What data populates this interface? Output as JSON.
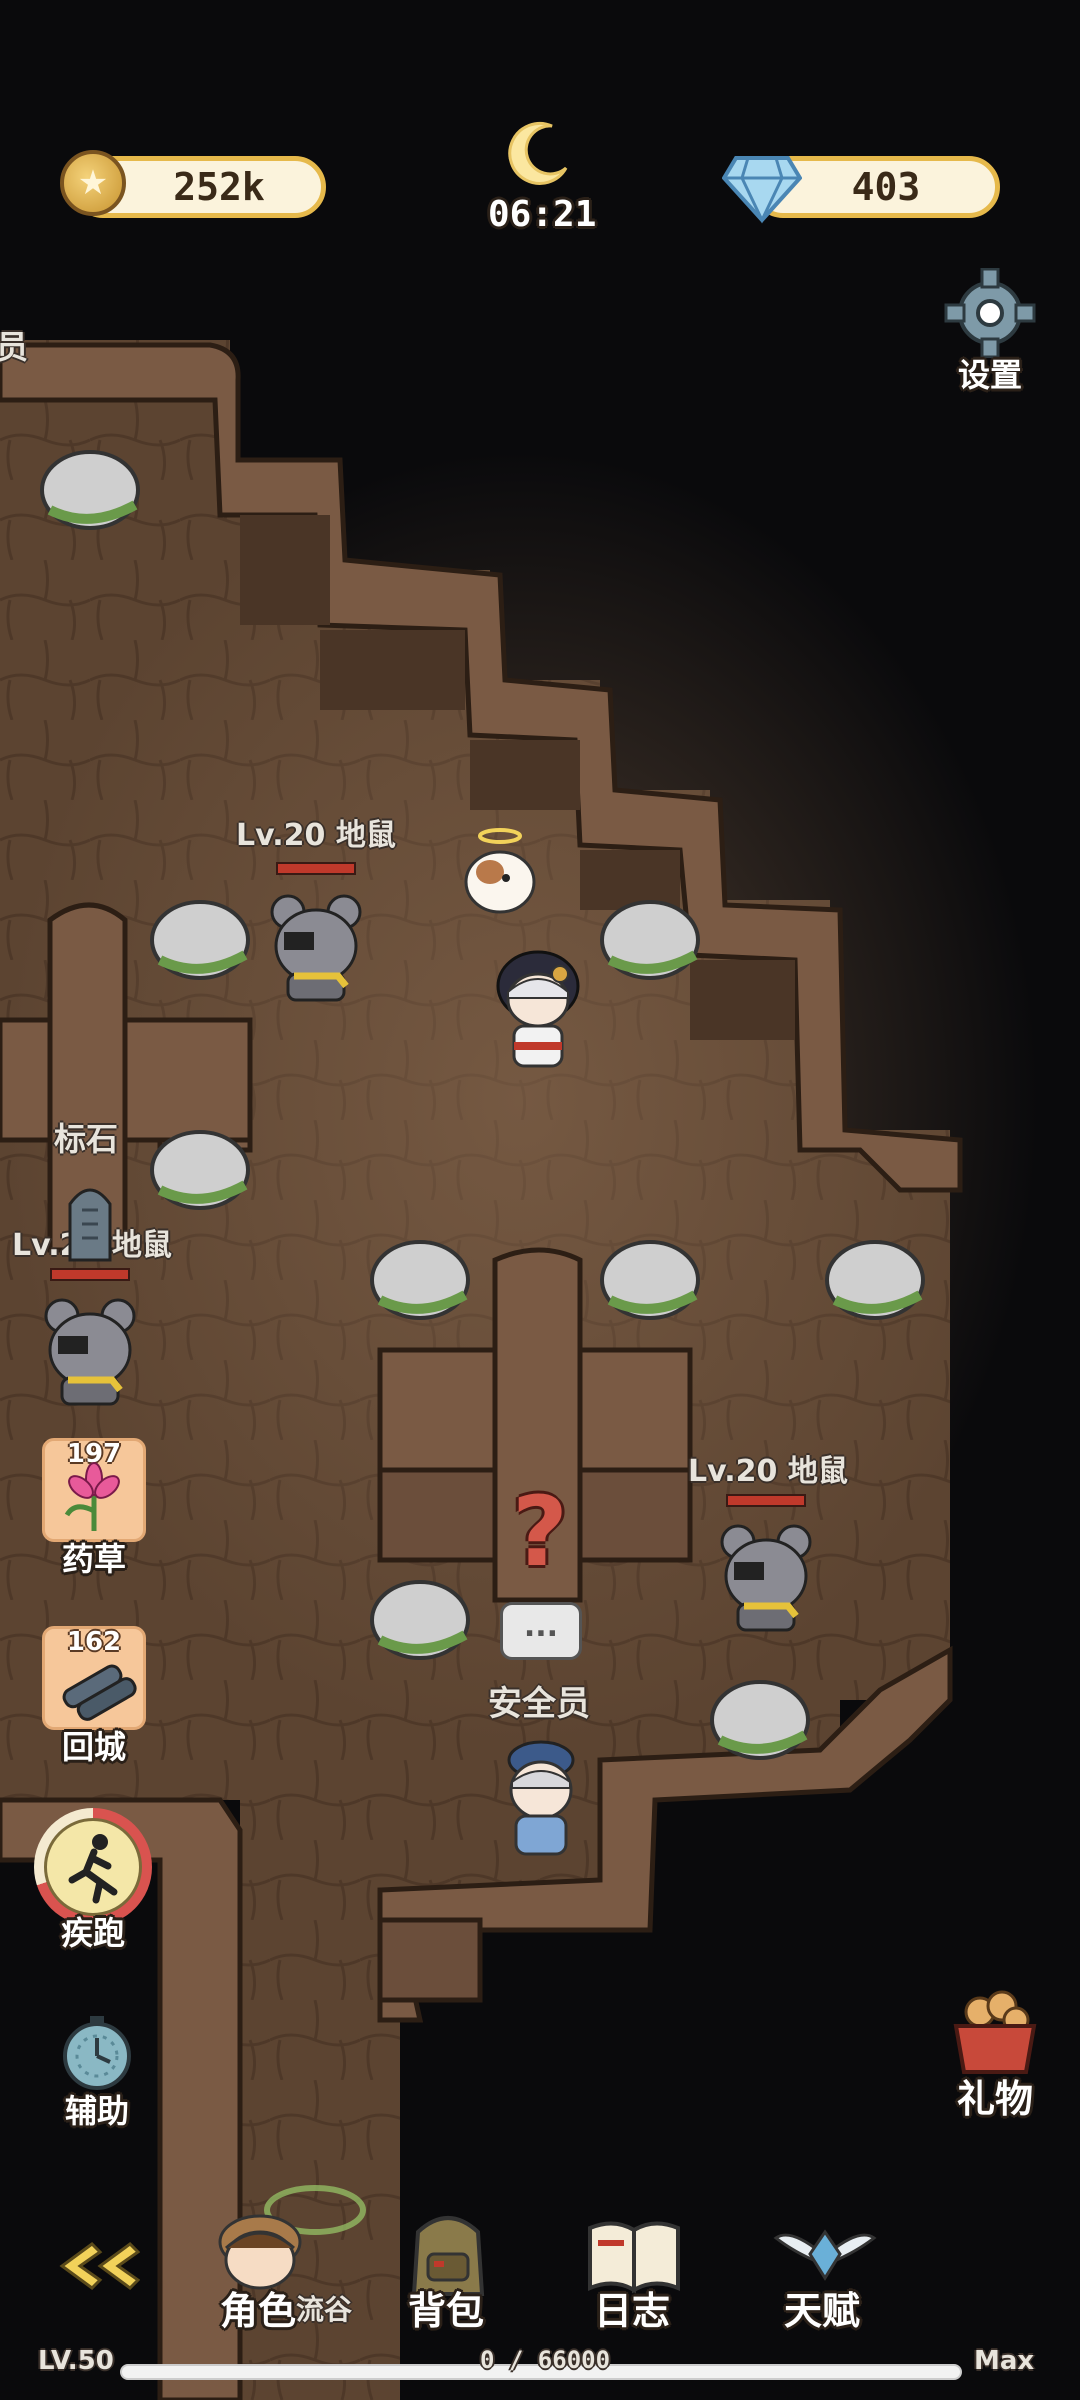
{
  "hud": {
    "coins": "252k",
    "gems": "403",
    "time": "06:21",
    "settings_label": "设置"
  },
  "map": {
    "offscreen_label": "员",
    "landmark_label": "标石",
    "npc_label": "安全员",
    "npc_bubble": "...",
    "quest_mark": "?",
    "enemies": [
      {
        "label": "Lv.20 地鼠"
      },
      {
        "label": "Lv.20 地鼠"
      },
      {
        "label": "Lv.20 地鼠"
      }
    ]
  },
  "side_items": {
    "herb": {
      "count": "197",
      "label": "药草"
    },
    "return_town": {
      "count": "162",
      "label": "回城"
    }
  },
  "actions": {
    "sprint_label": "疾跑",
    "assist_label": "辅助",
    "gift_label": "礼物"
  },
  "bottom_nav": {
    "character": "角色",
    "character_sub": "流谷",
    "backpack": "背包",
    "journal": "日志",
    "talent": "天赋"
  },
  "level": {
    "level": "LV.50",
    "xp": "0 / 66000",
    "max": "Max",
    "xp_progress": 0
  },
  "colors": {
    "gold_border": "#e6b94b",
    "pill_bg": "#fbf3dc",
    "cave_floor": "#5e4532",
    "cave_wall": "#7a5a44",
    "enemy_hp": "#c0392b"
  }
}
